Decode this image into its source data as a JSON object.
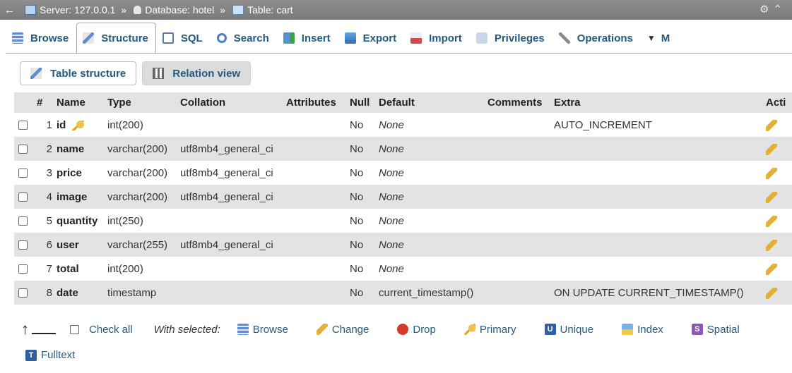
{
  "breadcrumb": {
    "server": "Server: 127.0.0.1",
    "database": "Database: hotel",
    "table": "Table: cart",
    "separator": "»"
  },
  "menu": {
    "tabs": [
      {
        "label": "Browse",
        "icon": "browse-icon"
      },
      {
        "label": "Structure",
        "icon": "structure-icon",
        "active": true
      },
      {
        "label": "SQL",
        "icon": "sql-icon"
      },
      {
        "label": "Search",
        "icon": "search-icon"
      },
      {
        "label": "Insert",
        "icon": "insert-icon"
      },
      {
        "label": "Export",
        "icon": "export-icon"
      },
      {
        "label": "Import",
        "icon": "import-icon"
      },
      {
        "label": "Privileges",
        "icon": "privileges-icon"
      },
      {
        "label": "Operations",
        "icon": "operations-icon"
      },
      {
        "label": "M",
        "icon": "chevron-down-icon"
      }
    ]
  },
  "subtabs": {
    "table_structure": "Table structure",
    "relation_view": "Relation view"
  },
  "table": {
    "headers": {
      "num": "#",
      "name": "Name",
      "type": "Type",
      "collation": "Collation",
      "attributes": "Attributes",
      "null": "Null",
      "default": "Default",
      "comments": "Comments",
      "extra": "Extra",
      "action": "Acti"
    },
    "rows": [
      {
        "num": "1",
        "name": "id",
        "type": "int(200)",
        "collation": "",
        "attributes": "",
        "null": "No",
        "default": "None",
        "comments": "",
        "extra": "AUTO_INCREMENT",
        "primary_key": true
      },
      {
        "num": "2",
        "name": "name",
        "type": "varchar(200)",
        "collation": "utf8mb4_general_ci",
        "attributes": "",
        "null": "No",
        "default": "None",
        "comments": "",
        "extra": ""
      },
      {
        "num": "3",
        "name": "price",
        "type": "varchar(200)",
        "collation": "utf8mb4_general_ci",
        "attributes": "",
        "null": "No",
        "default": "None",
        "comments": "",
        "extra": ""
      },
      {
        "num": "4",
        "name": "image",
        "type": "varchar(200)",
        "collation": "utf8mb4_general_ci",
        "attributes": "",
        "null": "No",
        "default": "None",
        "comments": "",
        "extra": ""
      },
      {
        "num": "5",
        "name": "quantity",
        "type": "int(250)",
        "collation": "",
        "attributes": "",
        "null": "No",
        "default": "None",
        "comments": "",
        "extra": ""
      },
      {
        "num": "6",
        "name": "user",
        "type": "varchar(255)",
        "collation": "utf8mb4_general_ci",
        "attributes": "",
        "null": "No",
        "default": "None",
        "comments": "",
        "extra": ""
      },
      {
        "num": "7",
        "name": "total",
        "type": "int(200)",
        "collation": "",
        "attributes": "",
        "null": "No",
        "default": "None",
        "comments": "",
        "extra": ""
      },
      {
        "num": "8",
        "name": "date",
        "type": "timestamp",
        "collation": "",
        "attributes": "",
        "null": "No",
        "default": "current_timestamp()",
        "default_italic": false,
        "comments": "",
        "extra": "ON UPDATE CURRENT_TIMESTAMP()"
      }
    ]
  },
  "bulk": {
    "check_all": "Check all",
    "with_selected": "With selected:",
    "browse": "Browse",
    "change": "Change",
    "drop": "Drop",
    "primary": "Primary",
    "unique": "Unique",
    "index": "Index",
    "spatial": "Spatial",
    "fulltext": "Fulltext"
  },
  "colors": {
    "accent": "#235a81",
    "breadcrumb_bg": "#858585",
    "row_alt": "#e3e3e3"
  }
}
